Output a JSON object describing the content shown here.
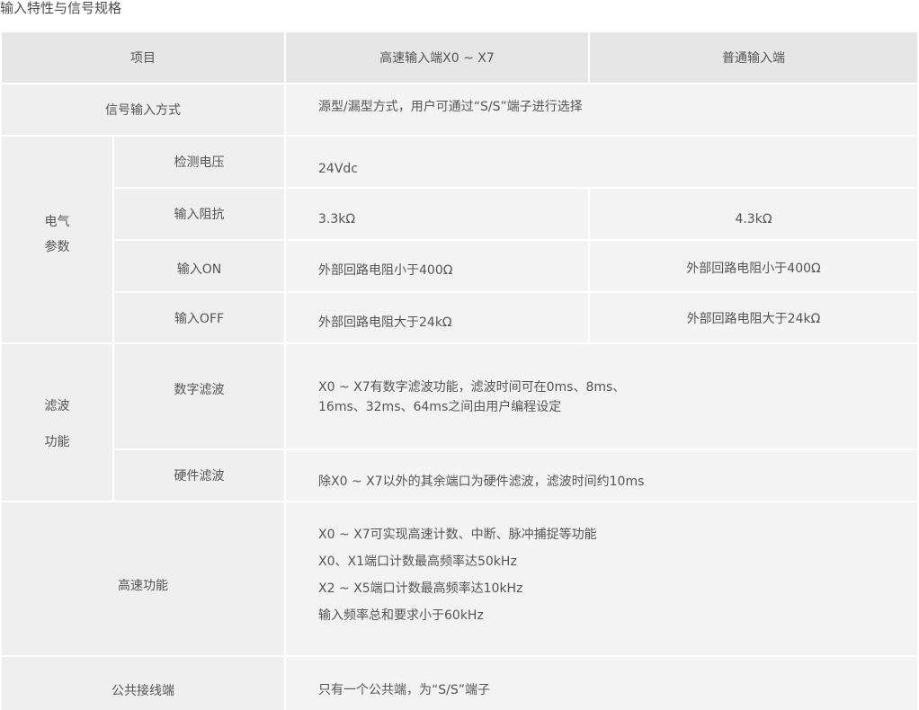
{
  "title": "输入特性与信号规格",
  "header": {
    "item": "项目",
    "high_speed": "高速输入端X0 ~ X7",
    "normal": "普通输入端"
  },
  "signal_input": {
    "label": "信号输入方式",
    "value": "源型/漏型方式，用户可通过“S/S”端子进行选择"
  },
  "electrical": {
    "group_line1": "电气",
    "group_line2": "参数",
    "detect_voltage": {
      "label": "检测电压",
      "value": "24Vdc"
    },
    "input_impedance": {
      "label": "输入阻抗",
      "high": "3.3kΩ",
      "normal": "4.3kΩ"
    },
    "input_on": {
      "label": "输入ON",
      "high": "外部回路电阻小于400Ω",
      "normal": "外部回路电阻小于400Ω"
    },
    "input_off": {
      "label": "输入OFF",
      "high": "外部回路电阻大于24kΩ",
      "normal": "外部回路电阻大于24kΩ"
    }
  },
  "filter": {
    "group_line1": "滤波",
    "group_line2": "功能",
    "digital": {
      "label": "数字滤波",
      "line1": "X0 ~ X7有数字滤波功能，滤波时间可在0ms、8ms、",
      "line2": "16ms、32ms、64ms之间由用户编程设定"
    },
    "hardware": {
      "label": "硬件滤波",
      "value": "除X0 ~ X7以外的其余端口为硬件滤波，滤波时间约10ms"
    }
  },
  "high_speed_function": {
    "label": "高速功能",
    "lines": [
      "X0 ~ X7可实现高速计数、中断、脉冲捕捉等功能",
      "X0、X1端口计数最高频率达50kHz",
      "X2 ~ X5端口计数最高频率达10kHz",
      "输入频率总和要求小于60kHz"
    ]
  },
  "common_terminal": {
    "label": "公共接线端",
    "value": "只有一个公共端，为“S/S”端子"
  }
}
